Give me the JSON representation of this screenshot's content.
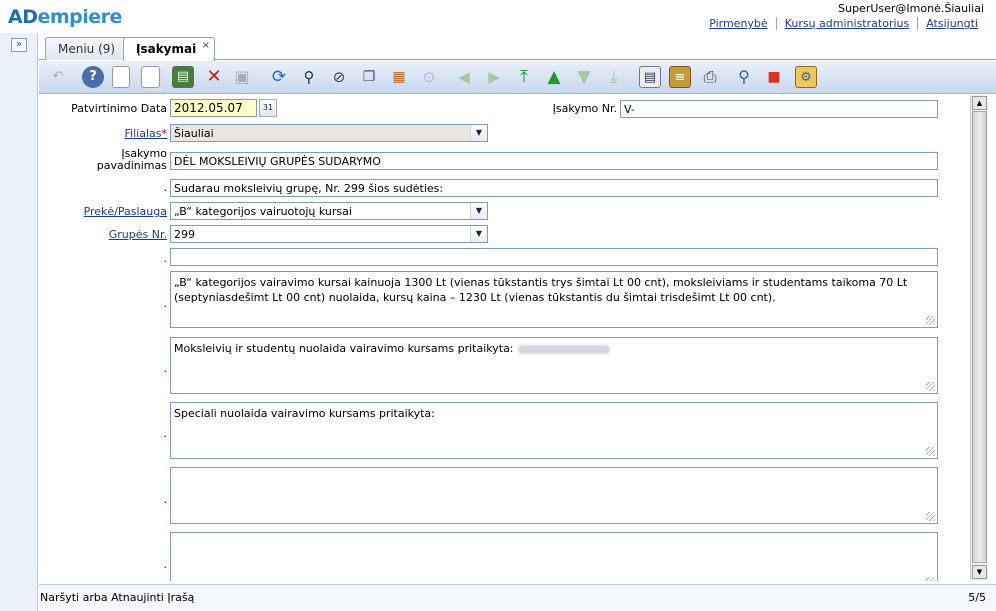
{
  "app": {
    "logo_a": "AD",
    "logo_rest": "empiere"
  },
  "header": {
    "user": "SuperUser@Imonė.Šiauliai",
    "links": [
      "Pirmenybė",
      "Kursų administratorius",
      "Atsijungti"
    ]
  },
  "tabs": [
    {
      "label": "Meniu (9)"
    },
    {
      "label": "Įsakymai",
      "close": "×"
    }
  ],
  "icons": {
    "expand": "»",
    "toolbar": [
      "undo-icon",
      "help-icon",
      "new-record-icon",
      "copy-record-icon",
      "delete-selection-icon",
      "delete-icon",
      "save-icon",
      "refresh-icon",
      "find-icon",
      "attachment-icon",
      "chat-icon",
      "grid-toggle-icon",
      "history-icon",
      "previous-record-icon",
      "next-record-icon",
      "first-record-icon",
      "parent-record-icon",
      "detail-record-icon",
      "last-record-icon",
      "report-icon",
      "archive-icon",
      "print-icon",
      "zoom-across-icon",
      "requests-icon",
      "workflow-icon"
    ]
  },
  "form": {
    "date_label": "Patvirtinimo Data",
    "date_value": "2012.05.07",
    "cal_icon": "31",
    "docno_label": "Įsakymo Nr.",
    "docno_value": "V-",
    "branch_label": "Filialas",
    "branch_req": "*",
    "branch_value": "Šiauliai",
    "name_label_1": "Įsakymo",
    "name_label_2": "pavadinimas",
    "name_value": "DĖL MOKSLEIVIŲ GRUPĖS SUDARYMO",
    "desc_label": ".",
    "desc_value": "Sudarau moksleivių grupę, Nr. 299 šios sudėties:",
    "product_label": "Prekė/Paslauga",
    "product_value": "„B“ kategorijos vairuotojų kursai",
    "group_label": "Grupės Nr.",
    "group_value": "299",
    "dot": ".",
    "text1": "„B“ kategorijos vairavimo kursai kainuoja 1300 Lt (vienas tūkstantis trys šimtai Lt 00 cnt), moksleiviams ir studentams taikoma 70 Lt (septyniasdešimt Lt 00 cnt) nuolaida, kursų kaina – 1230 Lt (vienas tūkstantis du šimtai trisdešimt Lt 00 cnt).",
    "text2": "Moksleivių ir studentų nuolaida vairavimo kursams pritaikyta:",
    "text3": "Speciali nuolaida vairavimo kursams pritaikyta:",
    "dropdown_arrow": "▼"
  },
  "scroll": {
    "up": "▲",
    "down": "▼"
  },
  "status": {
    "message": "Naršyti arba Atnaujinti Įrašą",
    "count": "5/5"
  },
  "colors": {
    "accent": "#2f8fcf",
    "link": "#1a3d8f",
    "date_bg": "#ffffc8",
    "branch_bg": "#e9e5e1",
    "toolbar_top": "#e9f0f9",
    "toolbar_bottom": "#c7d8ee"
  }
}
